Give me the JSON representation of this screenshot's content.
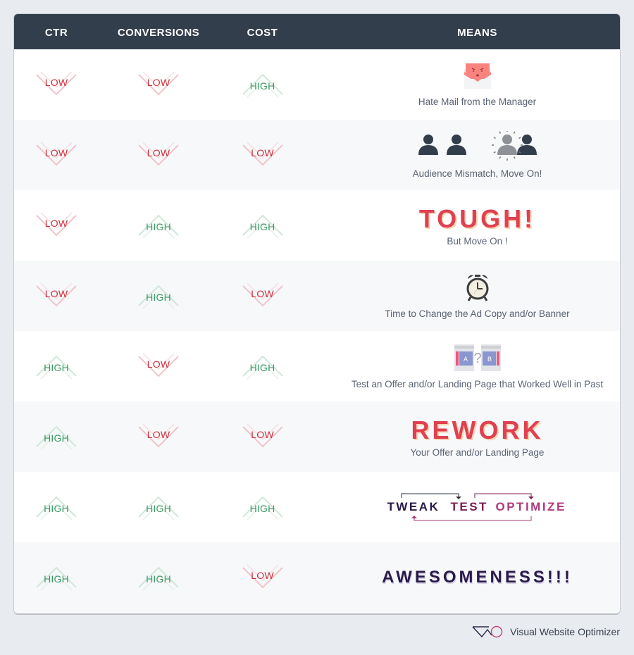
{
  "table": {
    "headers": {
      "ctr": "CTR",
      "conversions": "CONVERSIONS",
      "cost": "COST",
      "means": "MEANS"
    },
    "rows": [
      {
        "ctr": "LOW",
        "conversions": "LOW",
        "cost": "HIGH",
        "means": {
          "type": "icon",
          "icon": "angry-mail-icon",
          "caption": "Hate Mail from the Manager"
        }
      },
      {
        "ctr": "LOW",
        "conversions": "LOW",
        "cost": "LOW",
        "means": {
          "type": "icon",
          "icon": "audience-people-icon",
          "caption": "Audience Mismatch, Move On!"
        }
      },
      {
        "ctr": "LOW",
        "conversions": "HIGH",
        "cost": "HIGH",
        "means": {
          "type": "headline",
          "headline": "TOUGH!",
          "caption": "But Move On !"
        }
      },
      {
        "ctr": "LOW",
        "conversions": "HIGH",
        "cost": "LOW",
        "means": {
          "type": "icon",
          "icon": "alarm-clock-icon",
          "caption": "Time to Change the Ad Copy and/or Banner"
        }
      },
      {
        "ctr": "HIGH",
        "conversions": "LOW",
        "cost": "HIGH",
        "means": {
          "type": "icon",
          "icon": "ab-test-icon",
          "icon_labels": [
            "A",
            "?",
            "B"
          ],
          "caption": "Test an Offer and/or Landing Page that Worked Well in Past"
        }
      },
      {
        "ctr": "HIGH",
        "conversions": "LOW",
        "cost": "LOW",
        "means": {
          "type": "headline",
          "headline": "REWORK",
          "caption": "Your Offer and/or Landing Page"
        }
      },
      {
        "ctr": "HIGH",
        "conversions": "HIGH",
        "cost": "HIGH",
        "means": {
          "type": "cycle",
          "steps": [
            "TWEAK",
            "TEST",
            "OPTIMIZE"
          ]
        }
      },
      {
        "ctr": "HIGH",
        "conversions": "HIGH",
        "cost": "LOW",
        "means": {
          "type": "headline",
          "headline": "AWESOMENESS!!!"
        }
      }
    ]
  },
  "colors": {
    "header_bg": "#333e4c",
    "low": "#c8323f",
    "high": "#3d9a65",
    "headline_red": "#e0404f",
    "tweak": "#2a1a4a",
    "test": "#7a1d4f",
    "optimize": "#b03a7c"
  },
  "footer": {
    "brand": "Visual Website Optimizer",
    "logo": "vwo-logo-icon"
  }
}
